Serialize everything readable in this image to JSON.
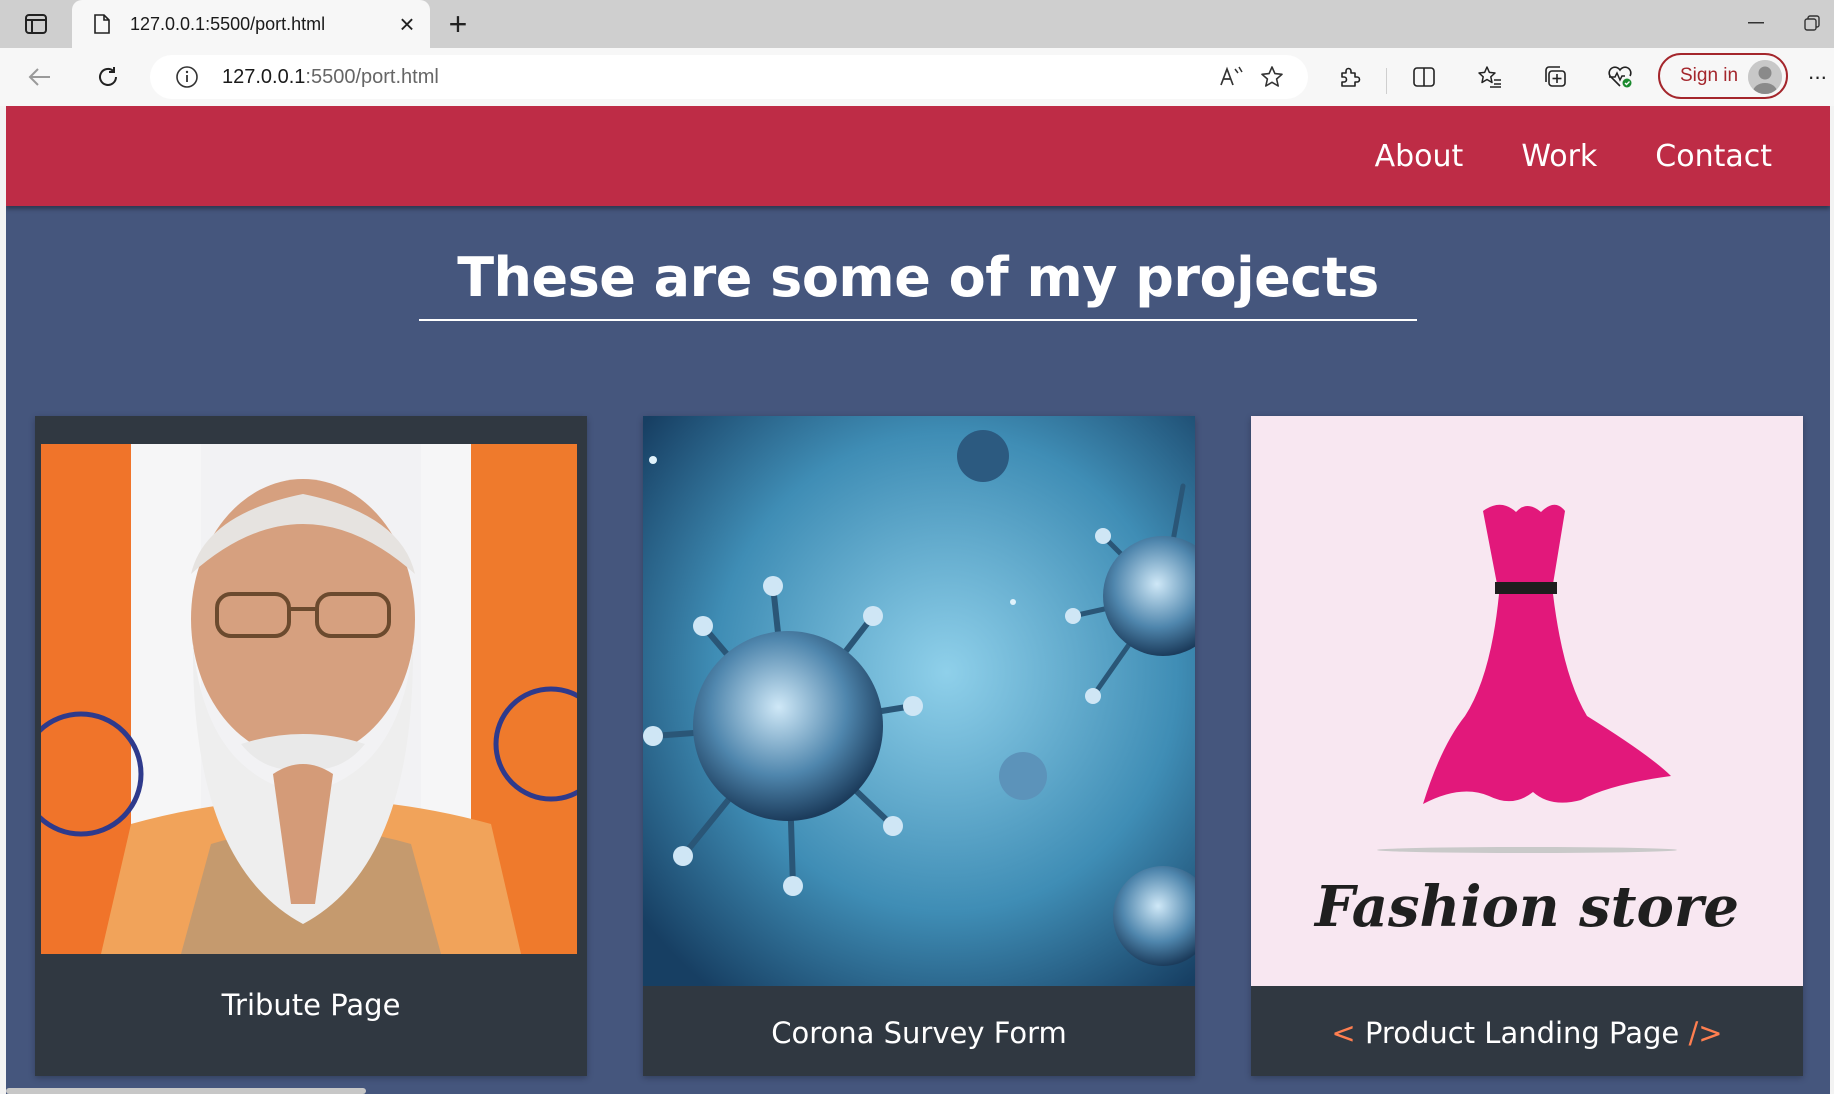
{
  "browser": {
    "tab_title": "127.0.0.1:5500/port.html",
    "new_tab_symbol": "+",
    "close_symbol": "×",
    "url_host": "127.0.0.1",
    "url_rest": ":5500/port.html",
    "signin_label": "Sign in",
    "more_symbol": "···"
  },
  "nav": {
    "links": [
      "About",
      "Work",
      "Contact"
    ]
  },
  "main": {
    "heading": "These are some of my projects"
  },
  "projects": [
    {
      "title": "Tribute Page",
      "image": "portrait-photo"
    },
    {
      "title": "Corona Survey Form",
      "image": "virus-illustration"
    },
    {
      "title": "Product Landing Page",
      "image": "fashion-store-logo",
      "open_bracket": "<",
      "close_bracket": "/>",
      "logo_text": "Fashion store"
    }
  ],
  "colors": {
    "navbar": "#be2c46",
    "page_bg": "#45567d",
    "card_bg": "#303841",
    "bracket_accent": "#ff7f50",
    "signin_accent": "#a4262c"
  }
}
